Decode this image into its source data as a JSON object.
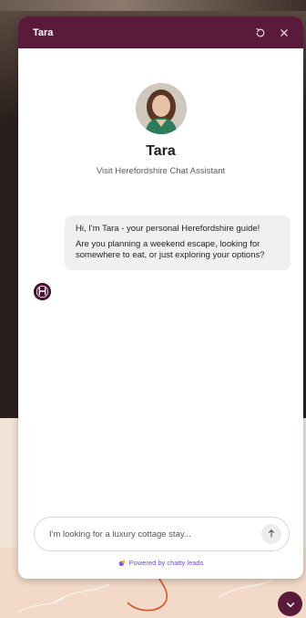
{
  "colors": {
    "header_bg": "#5a1a3a",
    "bubble_bg": "#f0f0f0",
    "powered_text": "#6a4fc8",
    "scroll_button": "#5a1a3a"
  },
  "header": {
    "title": "Tara",
    "refresh_icon": "refresh-icon",
    "close_icon": "close-icon"
  },
  "profile": {
    "name": "Tara",
    "subtitle": "Visit Herefordshire Chat Assistant"
  },
  "messages": [
    {
      "sender": "bot",
      "avatar_letter": "H",
      "paragraphs": [
        "Hi, I'm Tara - your personal Herefordshire guide!",
        "Are you planning a weekend escape, looking for somewhere to eat, or just exploring your options?"
      ]
    }
  ],
  "composer": {
    "placeholder": "I'm looking for a luxury cottage stay...",
    "value": "",
    "send_icon": "arrow-up-icon"
  },
  "footer": {
    "powered_by": "Powered by chatty leads"
  },
  "scroll_button": {
    "icon": "chevron-down-icon"
  }
}
